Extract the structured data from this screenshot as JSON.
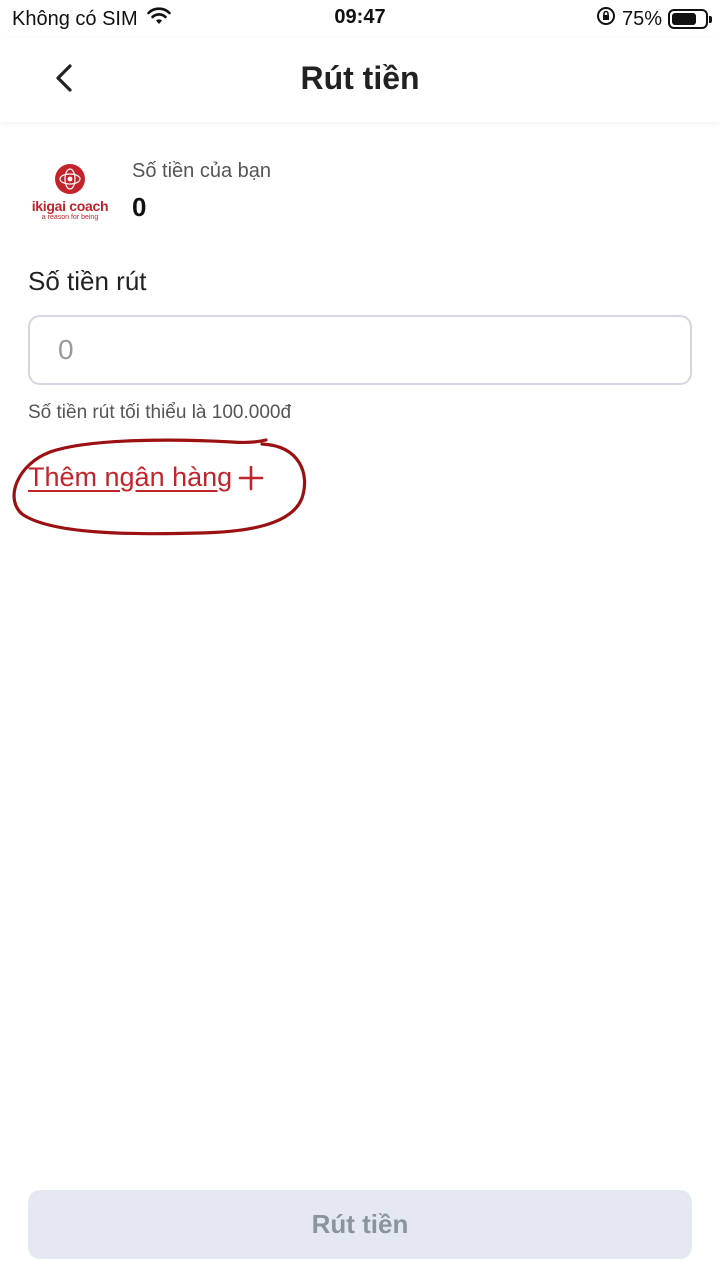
{
  "status_bar": {
    "carrier": "Không có SIM",
    "time": "09:47",
    "battery_percent": "75%",
    "battery_level": 0.75,
    "icons": [
      "wifi-icon",
      "orientation-lock-icon",
      "battery-icon"
    ]
  },
  "nav": {
    "title": "Rút tiền",
    "back_icon": "chevron-left-icon"
  },
  "balance": {
    "logo_text": "ikigai coach",
    "logo_tagline": "a reason for being",
    "label": "Số tiền của bạn",
    "value": "0"
  },
  "withdraw": {
    "label": "Số tiền rút",
    "input_value": "",
    "input_placeholder": "0",
    "hint": "Số tiền rút tối thiểu là 100.000đ"
  },
  "add_bank": {
    "label": "Thêm ngân hàng",
    "icon": "plus-icon"
  },
  "submit": {
    "label": "Rút tiền"
  },
  "colors": {
    "brand_red": "#c3242b",
    "annotation_red": "#9b1111",
    "disabled_button_bg": "#e4e8f0",
    "disabled_button_text": "#8d939c",
    "input_border": "#d4d7e3"
  }
}
